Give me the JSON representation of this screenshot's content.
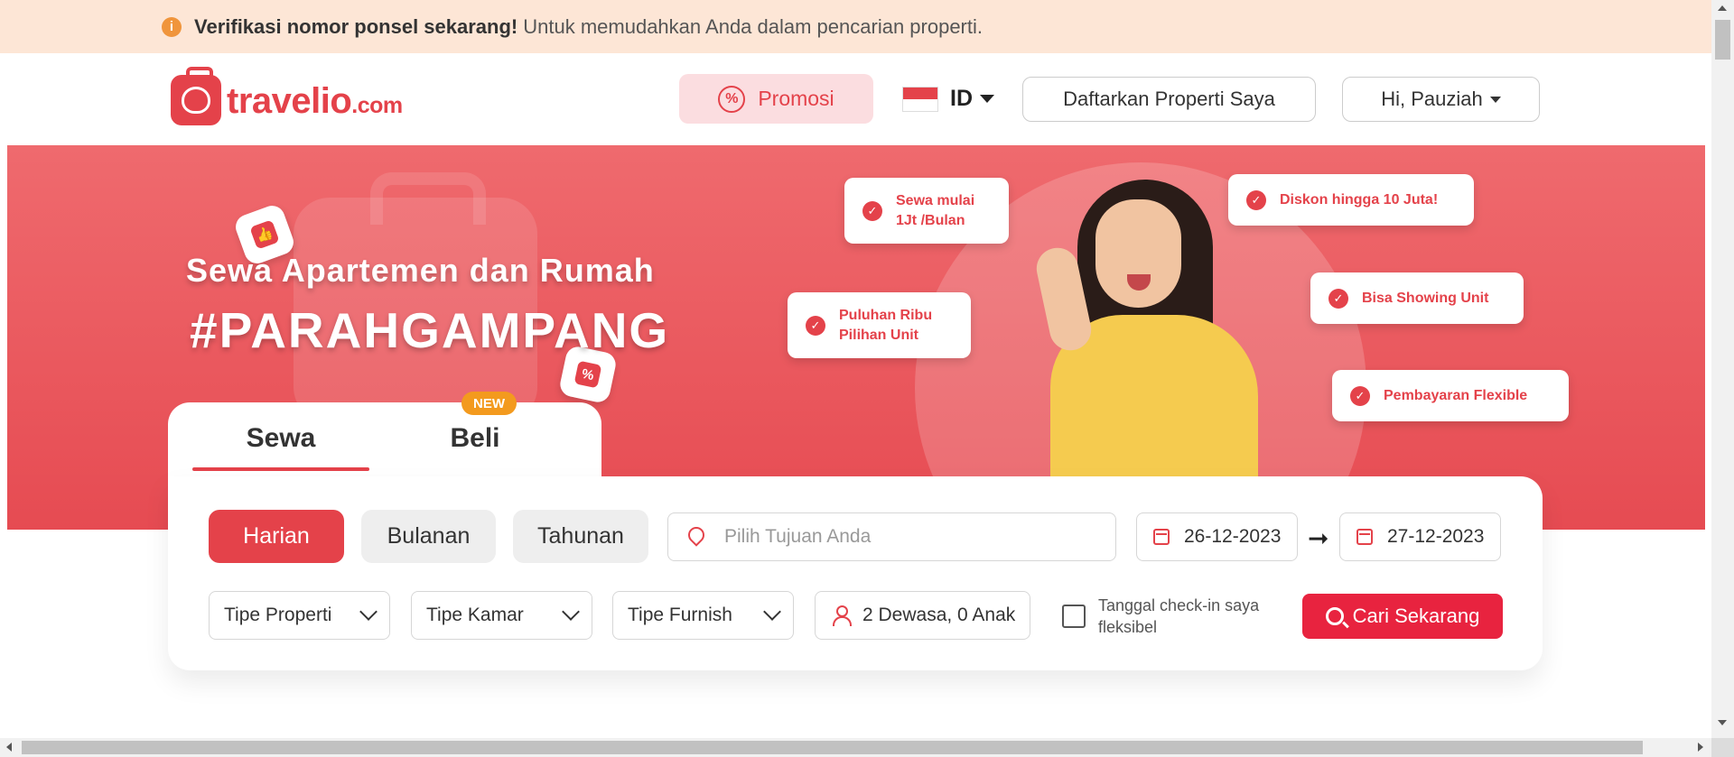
{
  "notice": {
    "bold_text": "Verifikasi nomor ponsel sekarang!",
    "text": "Untuk memudahkan Anda dalam pencarian properti."
  },
  "header": {
    "logo_main": "travelio",
    "logo_suffix": ".com",
    "promo_label": "Promosi",
    "lang_code": "ID",
    "list_property_label": "Daftarkan Properti Saya",
    "user_greeting": "Hi, Pauziah"
  },
  "hero": {
    "title": "Sewa Apartemen dan Rumah",
    "tagline": "#PARAHGAMPANG",
    "features": [
      "Sewa mulai 1Jt /Bulan",
      "Diskon hingga 10 Juta!",
      "Puluhan Ribu Pilihan Unit",
      "Bisa Showing Unit",
      "Pembayaran Flexible"
    ]
  },
  "search": {
    "tabs": [
      {
        "label": "Sewa",
        "active": true
      },
      {
        "label": "Beli",
        "active": false
      }
    ],
    "new_badge": "NEW",
    "durations": [
      {
        "label": "Harian",
        "active": true
      },
      {
        "label": "Bulanan",
        "active": false
      },
      {
        "label": "Tahunan",
        "active": false
      }
    ],
    "destination_placeholder": "Pilih Tujuan Anda",
    "checkin_date": "26-12-2023",
    "checkout_date": "27-12-2023",
    "property_type": "Tipe Properti",
    "room_type": "Tipe Kamar",
    "furnish_type": "Tipe Furnish",
    "guests": "2 Dewasa, 0 Anak",
    "flexible_label": "Tanggal check-in saya fleksibel",
    "submit_label": "Cari Sekarang"
  },
  "colors": {
    "brand_red": "#e4424a",
    "hero_bg": "#ef6a6e",
    "notice_bg": "#fde6d6",
    "new_badge": "#f39a1e",
    "cta_red": "#e8233f"
  }
}
